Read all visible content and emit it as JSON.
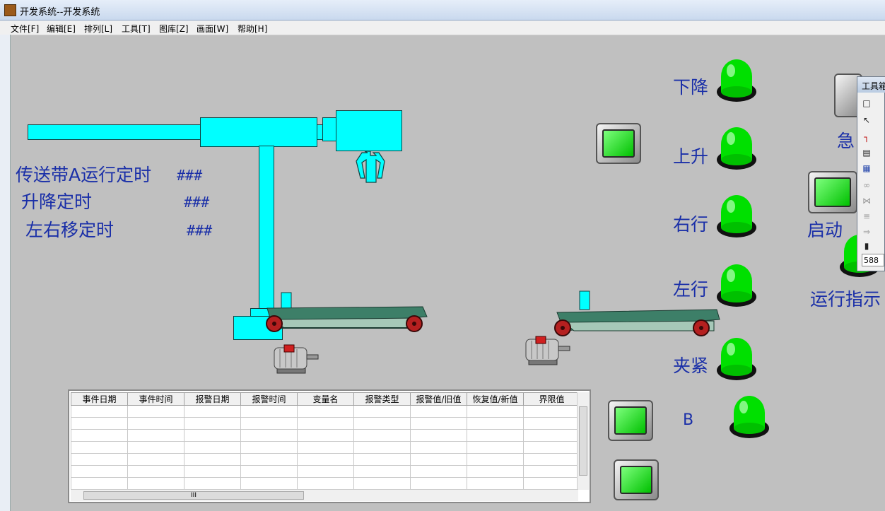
{
  "window": {
    "title": "开发系统--开发系统"
  },
  "menu": [
    "文件[F]",
    "编辑[E]",
    "排列[L]",
    "工具[T]",
    "图库[Z]",
    "画面[W]",
    "帮助[H]"
  ],
  "timers": {
    "conveyor_a_label": "传送带A运行定时",
    "conveyor_a_value": "###",
    "lift_label": "升降定时",
    "lift_value": "###",
    "lr_label": "左右移定时",
    "lr_value": "###"
  },
  "indicators": {
    "down": "下降",
    "up": "上升",
    "right": "右行",
    "left": "左行",
    "clamp": "夹紧",
    "b": "B"
  },
  "controls": {
    "emergency": "急",
    "start": "启动",
    "run_indicator": "运行指示"
  },
  "alarm_table": {
    "columns": [
      "事件日期",
      "事件时间",
      "报警日期",
      "报警时间",
      "变量名",
      "报警类型",
      "报警值/旧值",
      "恢复值/新值",
      "界限值"
    ],
    "rows": [
      [],
      [],
      [],
      [],
      [],
      [],
      []
    ],
    "hscroll_grip": "III"
  },
  "toolbox": {
    "title": "工具箱",
    "value": "588"
  },
  "colors": {
    "label_blue": "#1a2fa8",
    "lamp_green": "#00e000",
    "machine_cyan": "#00ffff",
    "belt_green": "#2f6f5a",
    "motor_red": "#d02020"
  }
}
